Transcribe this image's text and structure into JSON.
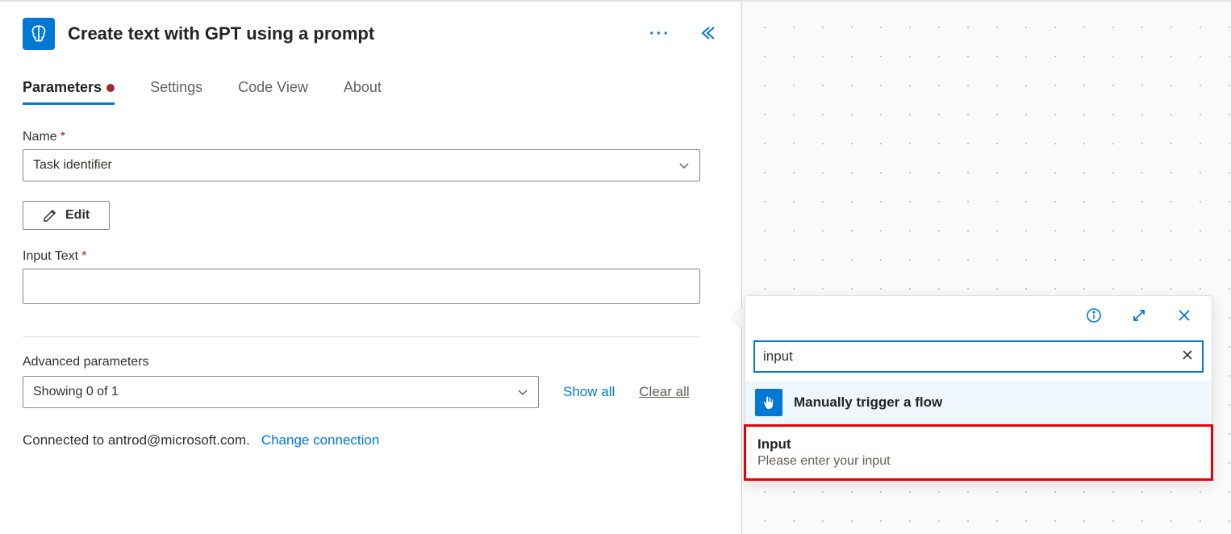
{
  "header": {
    "title": "Create text with GPT using a prompt"
  },
  "tabs": [
    {
      "label": "Parameters",
      "indicator": true
    },
    {
      "label": "Settings"
    },
    {
      "label": "Code View"
    },
    {
      "label": "About"
    }
  ],
  "fields": {
    "name": {
      "label": "Name",
      "value": "Task identifier"
    },
    "editButton": "Edit",
    "inputText": {
      "label": "Input Text",
      "value": ""
    }
  },
  "advanced": {
    "label": "Advanced parameters",
    "selectValue": "Showing 0 of 1",
    "showAll": "Show all",
    "clearAll": "Clear all"
  },
  "connection": {
    "text": "Connected to antrod@microsoft.com.",
    "changeLink": "Change connection"
  },
  "popup": {
    "searchValue": "input",
    "resultHeader": "Manually trigger a flow",
    "item": {
      "title": "Input",
      "desc": "Please enter your input"
    }
  }
}
